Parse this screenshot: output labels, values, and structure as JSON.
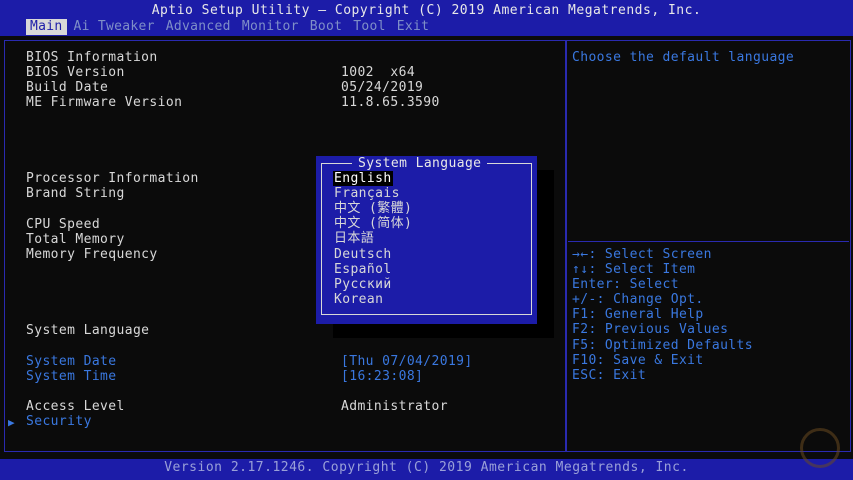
{
  "title": "Aptio Setup Utility – Copyright (C) 2019 American Megatrends, Inc.",
  "menu": {
    "items": [
      "Main",
      "Ai Tweaker",
      "Advanced",
      "Monitor",
      "Boot",
      "Tool",
      "Exit"
    ],
    "active": "Main"
  },
  "main": {
    "bios_info_heading": "BIOS Information",
    "bios_version_label": "BIOS Version",
    "bios_version_value": "1002  x64",
    "build_date_label": "Build Date",
    "build_date_value": "05/24/2019",
    "me_fw_label": "ME Firmware Version",
    "me_fw_value": "11.8.65.3590",
    "processor_info_label": "Processor Information",
    "brand_string_label": "Brand String",
    "cpu_speed_label": "CPU Speed",
    "total_memory_label": "Total Memory",
    "memory_frequency_label": "Memory Frequency",
    "system_language_label": "System Language",
    "system_date_label": "System Date",
    "system_date_value": "[Thu 07/04/2019]",
    "system_time_label": "System Time",
    "system_time_value": "[16:23:08]",
    "access_level_label": "Access Level",
    "access_level_value": "Administrator",
    "security_label": "Security",
    "security_arrow": "▶"
  },
  "popup": {
    "title": "System Language",
    "options": [
      "English",
      "Français",
      "中文 (繁體)",
      "中文 (简体)",
      "日本語",
      "Deutsch",
      "Español",
      "Русский",
      "Korean"
    ],
    "selected": "English"
  },
  "help": {
    "description": "Choose the default language",
    "keys": [
      "→←: Select Screen",
      "↑↓: Select Item",
      "Enter: Select",
      "+/-: Change Opt.",
      "F1: General Help",
      "F2: Previous Values",
      "F5: Optimized Defaults",
      "F10: Save & Exit",
      "ESC: Exit"
    ]
  },
  "footer": "Version 2.17.1246. Copyright (C) 2019 American Megatrends, Inc.",
  "colors": {
    "bios_blue": "#1c1ca8",
    "highlight_blue": "#3a78e0",
    "text_white": "#d8d8d8"
  }
}
